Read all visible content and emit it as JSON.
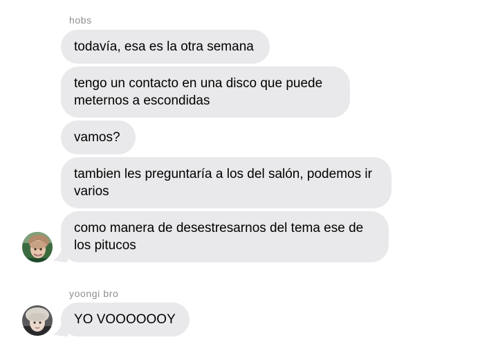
{
  "groups": [
    {
      "sender": "hobs",
      "messages": [
        "todavía, esa es la otra semana",
        "tengo un contacto en una disco que puede meternos a escondidas",
        "vamos?",
        "tambien les preguntaría a los del salón, podemos ir varios",
        "como manera de desestresarnos del tema ese de los pitucos"
      ]
    },
    {
      "sender": "yoongi bro",
      "messages": [
        "YO VOOOOOOY"
      ]
    }
  ],
  "avatars": [
    "profile-photo-icon",
    "profile-photo-icon"
  ],
  "colors": {
    "bubble": "#e9e9eb",
    "sender_name": "#8e8e93",
    "text": "#000000"
  }
}
